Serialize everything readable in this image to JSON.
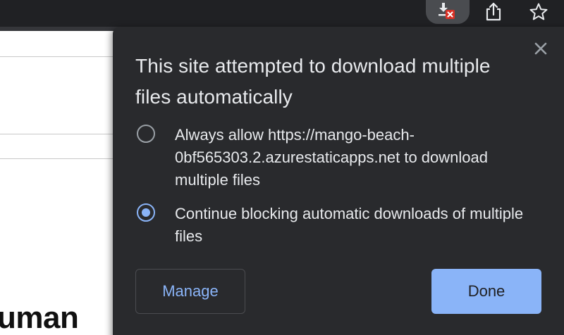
{
  "page": {
    "partial_heading": "uman"
  },
  "dialog": {
    "title": "This site attempted to download multiple files automatically",
    "options": [
      {
        "label": "Always allow https://mango-beach-0bf565303.2.azurestaticapps.net to download multiple files",
        "selected": false
      },
      {
        "label": "Continue blocking automatic downloads of multiple files",
        "selected": true
      }
    ],
    "manage_label": "Manage",
    "done_label": "Done"
  },
  "icons": {
    "downloads": "download-blocked-icon",
    "share": "share-icon",
    "star": "star-icon",
    "close": "close-icon"
  },
  "colors": {
    "dialog_bg": "#292a2d",
    "accent": "#8ab4f8",
    "text": "#e8eaed",
    "blocked_badge": "#d93025"
  }
}
